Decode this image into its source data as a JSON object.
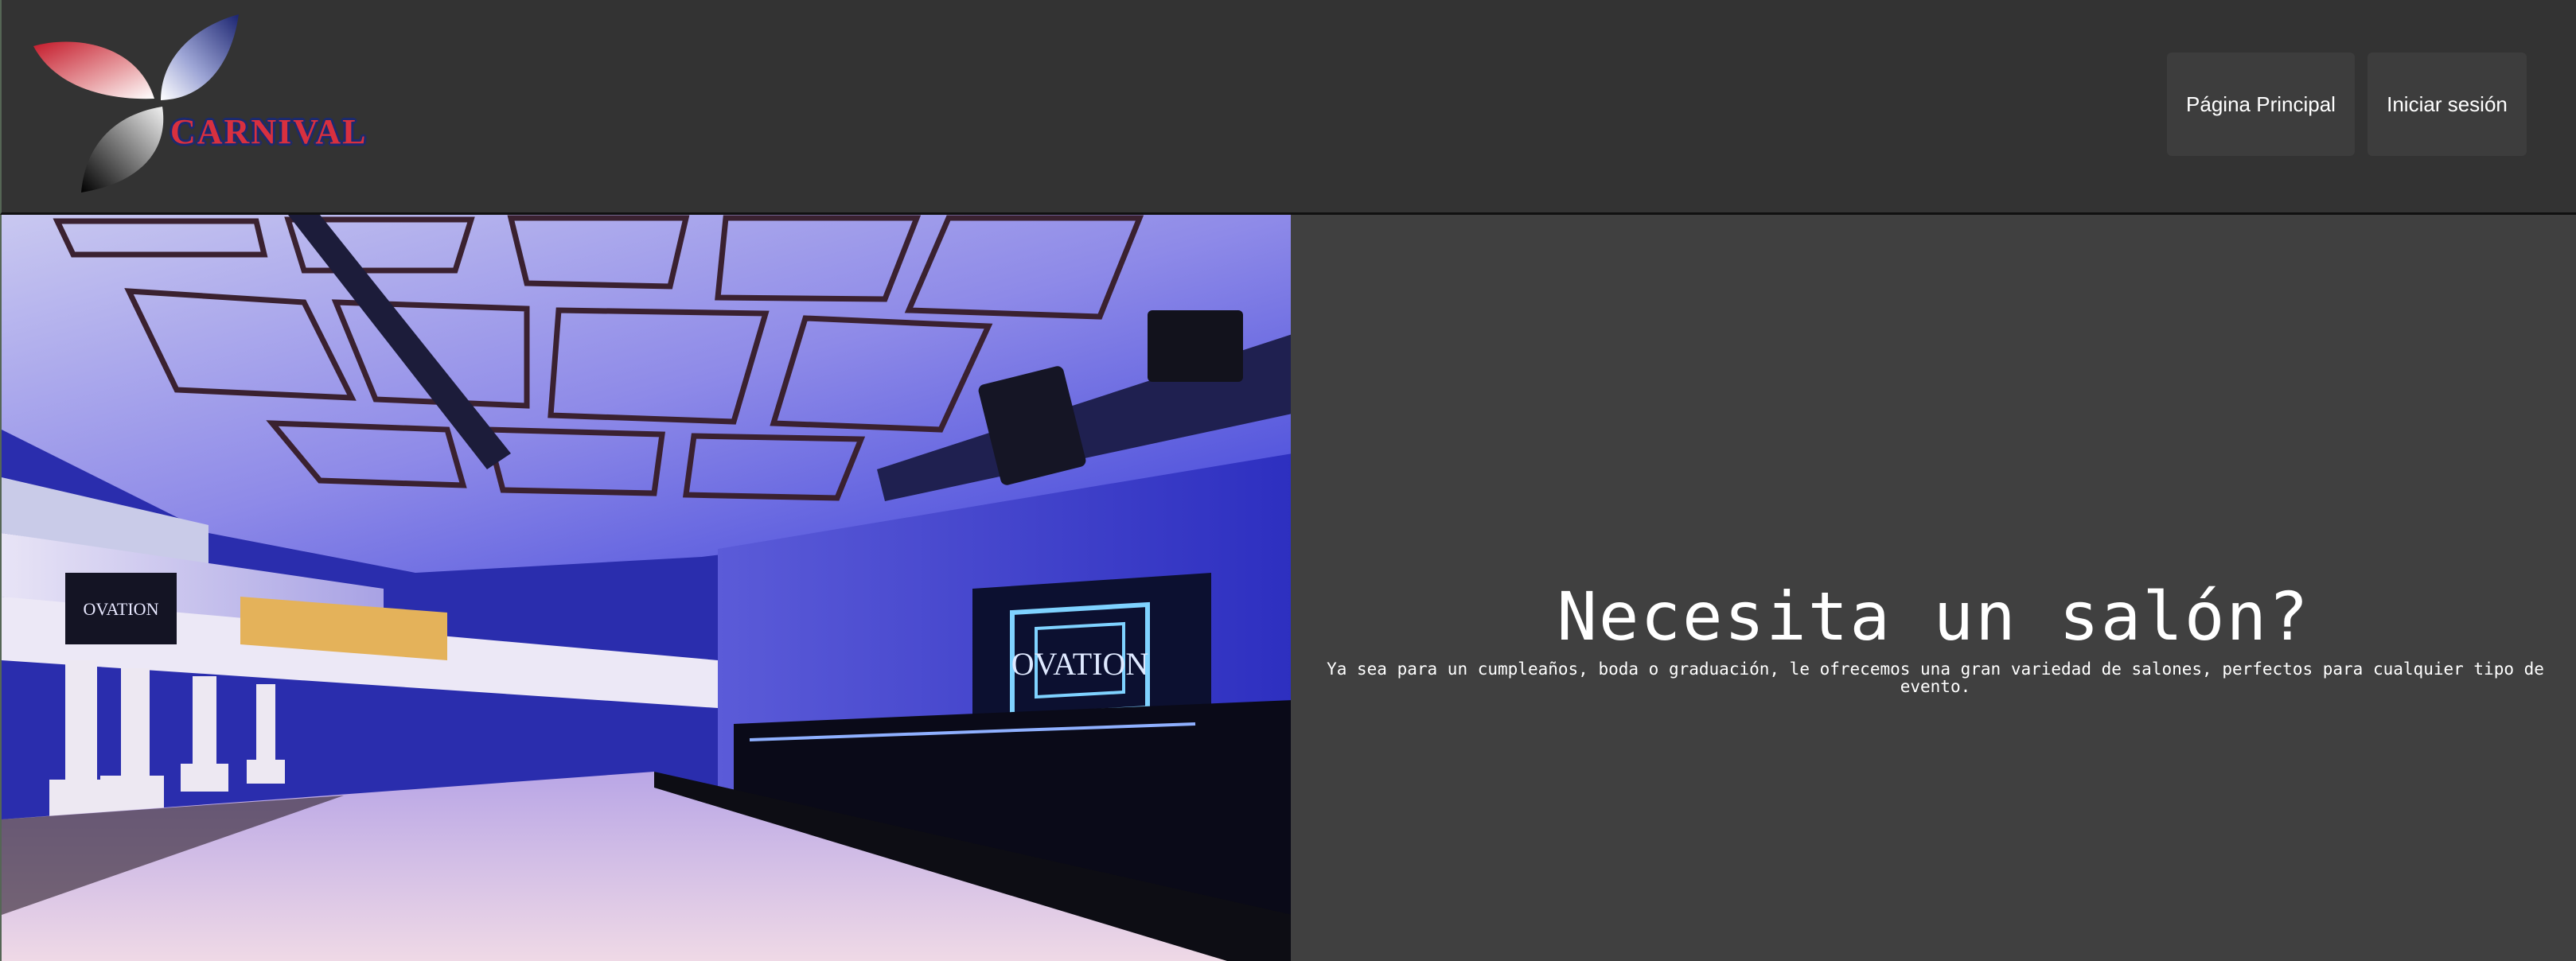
{
  "brand": {
    "name": "CARNIVAL"
  },
  "nav": {
    "home_label": "Página Principal",
    "login_label": "Iniciar sesión"
  },
  "hero": {
    "title": "Necesita un salón?",
    "subtitle": "Ya sea para un cumpleaños, boda o graduación, le ofrecemos una gran variedad de salones, perfectos para cualquier tipo de evento."
  },
  "photo": {
    "stage_sign": "OVATION",
    "balcony_sign": "OVATION"
  },
  "colors": {
    "header_bg": "#333333",
    "panel_bg": "#404040",
    "button_bg": "#3d3d3d",
    "text": "#ffffff",
    "brand_red": "#d8303f",
    "brand_navy": "#1c2a6e"
  },
  "icons": {
    "logo": "carnival-petal-logo"
  }
}
